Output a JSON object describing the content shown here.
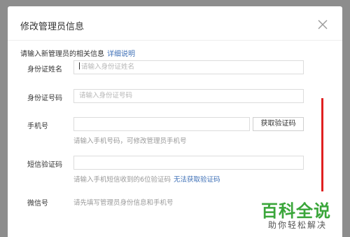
{
  "dialog": {
    "title": "修改管理员信息",
    "intro": "请输入新管理员的相关信息",
    "intro_link": "详细说明"
  },
  "form": {
    "name": {
      "label": "身份证姓名",
      "placeholder": "请输入身份证姓名"
    },
    "id_number": {
      "label": "身份证号码",
      "placeholder": "请输入身份证号码"
    },
    "phone": {
      "label": "手机号",
      "value": "",
      "button": "获取验证码",
      "hint": "请输入手机号码，可修改管理员手机号"
    },
    "sms_code": {
      "label": "短信验证码",
      "value": "",
      "hint": "请输入手机短信收到的6位验证码",
      "hint_link": "无法获取验证码"
    },
    "wechat": {
      "label": "微信号",
      "hint": "请先填写管理员身份信息和手机号"
    }
  },
  "watermark": {
    "main": "百科全说",
    "sub": "助你轻松解决"
  },
  "colors": {
    "link": "#3d6fb6",
    "annotation_bar": "#e02020",
    "watermark": "#3aa63a"
  },
  "icons": {
    "close": "close-icon"
  }
}
